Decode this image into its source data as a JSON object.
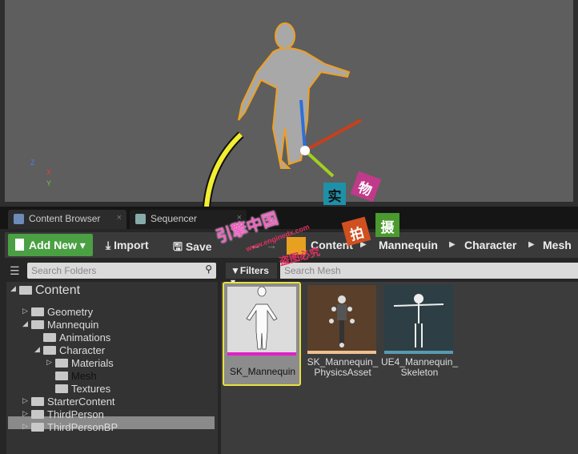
{
  "viewport": {
    "axis_x": "X",
    "axis_y": "Y",
    "axis_z": "Z"
  },
  "tabs": [
    {
      "label": "Content Browser",
      "close": "×"
    },
    {
      "label": "Sequencer",
      "close": "×"
    }
  ],
  "toolbar": {
    "add_new": "Add New",
    "import": "Import",
    "save": "Save All",
    "back": "←",
    "forward": "→"
  },
  "breadcrumb": [
    "Content",
    "Mannequin",
    "Character",
    "Mesh"
  ],
  "search": {
    "folders_placeholder": "Search Folders",
    "filters": "Filters",
    "mesh_placeholder": "Search Mesh"
  },
  "tree": [
    {
      "label": "Content",
      "level": 0,
      "expanded": true
    },
    {
      "label": "Geometry",
      "level": 1,
      "expanded": false
    },
    {
      "label": "Mannequin",
      "level": 1,
      "expanded": true
    },
    {
      "label": "Animations",
      "level": 2,
      "expanded": null
    },
    {
      "label": "Character",
      "level": 2,
      "expanded": true
    },
    {
      "label": "Materials",
      "level": 3,
      "expanded": false
    },
    {
      "label": "Mesh",
      "level": 3,
      "expanded": null,
      "selected": true
    },
    {
      "label": "Textures",
      "level": 3,
      "expanded": null
    },
    {
      "label": "StarterContent",
      "level": 1,
      "expanded": false
    },
    {
      "label": "ThirdPerson",
      "level": 1,
      "expanded": false
    },
    {
      "label": "ThirdPersonBP",
      "level": 1,
      "expanded": false
    }
  ],
  "assets": [
    {
      "line1": "SK_Mannequin",
      "line2": "",
      "color": "#e020c8",
      "selected": true
    },
    {
      "line1": "SK_Mannequin_",
      "line2": "PhysicsAsset",
      "color": "#f0c090"
    },
    {
      "line1": "UE4_Mannequin_",
      "line2": "Skeleton",
      "color": "#5a9ab0"
    }
  ],
  "watermark": {
    "brand": "引擎中国",
    "url": "www.enginedx.com",
    "notice": "盗图必究",
    "c1": "实",
    "c2": "物",
    "c3": "拍",
    "c4": "摄"
  },
  "colors": {
    "accent_green": "#4aa043",
    "selection_yellow": "#e8e040"
  }
}
